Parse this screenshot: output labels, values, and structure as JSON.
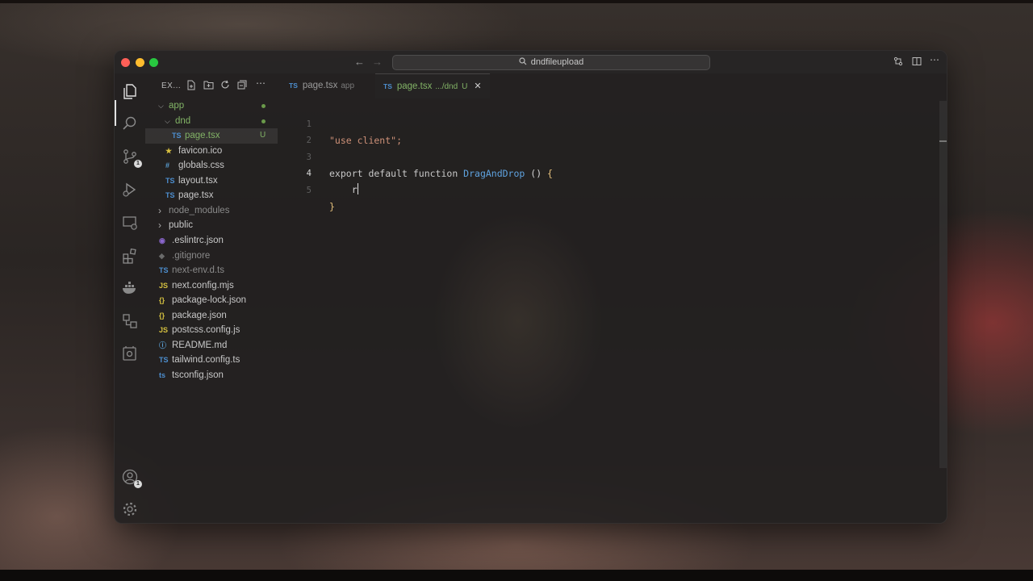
{
  "window": {
    "search": "dndfileupload"
  },
  "sidebar": {
    "title": "EX...",
    "tree": [
      {
        "name": "app",
        "kind": "folder-open",
        "status": "dot"
      },
      {
        "name": "dnd",
        "kind": "folder-open",
        "status": "dot"
      },
      {
        "name": "page.tsx",
        "kind": "ts",
        "status": "U"
      },
      {
        "name": "favicon.ico",
        "kind": "star"
      },
      {
        "name": "globals.css",
        "kind": "css"
      },
      {
        "name": "layout.tsx",
        "kind": "ts"
      },
      {
        "name": "page.tsx",
        "kind": "ts"
      },
      {
        "name": "node_modules",
        "kind": "folder"
      },
      {
        "name": "public",
        "kind": "folder"
      },
      {
        "name": ".eslintrc.json",
        "kind": "eslint"
      },
      {
        "name": ".gitignore",
        "kind": "git"
      },
      {
        "name": "next-env.d.ts",
        "kind": "ts"
      },
      {
        "name": "next.config.mjs",
        "kind": "js"
      },
      {
        "name": "package-lock.json",
        "kind": "json"
      },
      {
        "name": "package.json",
        "kind": "json"
      },
      {
        "name": "postcss.config.js",
        "kind": "js"
      },
      {
        "name": "README.md",
        "kind": "info"
      },
      {
        "name": "tailwind.config.ts",
        "kind": "ts"
      },
      {
        "name": "tsconfig.json",
        "kind": "tsconfig"
      }
    ]
  },
  "tabs": [
    {
      "lang": "TS",
      "name": "page.tsx",
      "sub": "app"
    },
    {
      "lang": "TS",
      "name": "page.tsx",
      "sub": ".../dnd",
      "status": "U"
    }
  ],
  "editor": {
    "lines": [
      {
        "num": "1",
        "text": "\"use client\";"
      },
      {
        "num": "2",
        "text": ""
      },
      {
        "num": "3",
        "kw": "export default function ",
        "fn": "DragAndDrop",
        "paren": " () ",
        "brace": "{"
      },
      {
        "num": "4",
        "text": "    r"
      },
      {
        "num": "5",
        "brace": "}"
      }
    ]
  },
  "activity_bar": {
    "source_control_badge": "1",
    "accounts_badge": "1"
  },
  "colors": {
    "accent_green": "#82b366",
    "ts_blue": "#4d8fd0",
    "function_blue": "#5fa3e0",
    "brace_yellow": "#e5c07b"
  }
}
